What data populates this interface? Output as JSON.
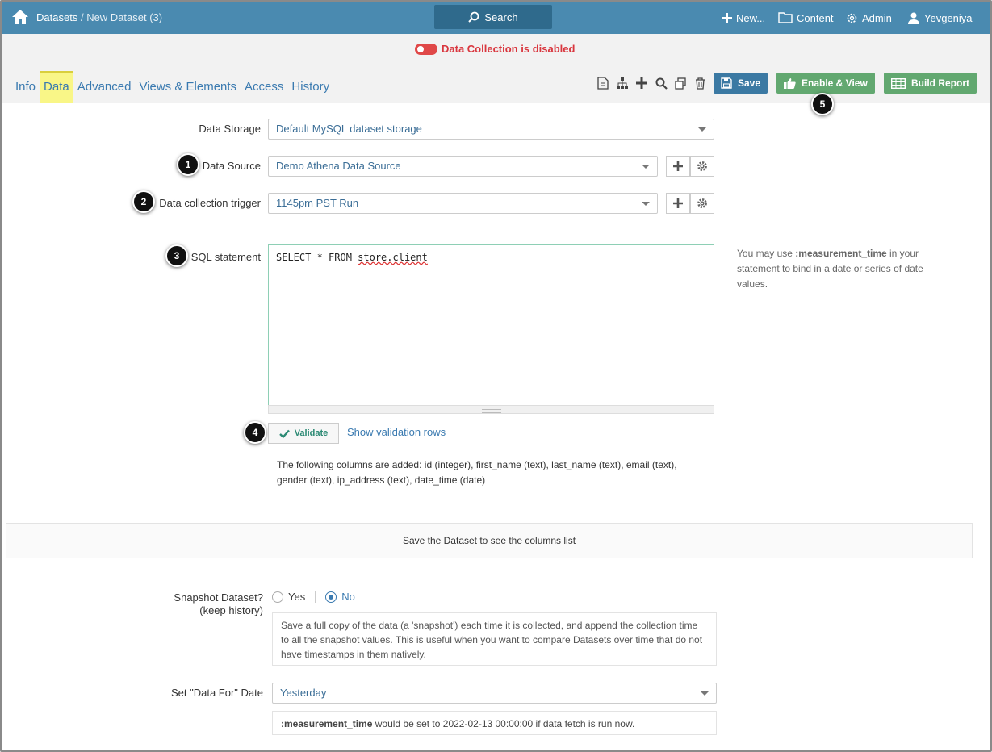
{
  "topbar": {
    "breadcrumb_root": "Datasets",
    "breadcrumb_sep": "/",
    "breadcrumb_current": "New Dataset (3)",
    "search_label": "Search",
    "new_label": "New...",
    "content_label": "Content",
    "admin_label": "Admin",
    "user_label": "Yevgeniya",
    "bg_color": "#4a8ab0"
  },
  "status": {
    "text": "Data Collection is disabled",
    "color": "#d9363e"
  },
  "tabs": [
    {
      "label": "Info"
    },
    {
      "label": "Data",
      "active": true
    },
    {
      "label": "Advanced"
    },
    {
      "label": "Views & Elements"
    },
    {
      "label": "Access"
    },
    {
      "label": "History"
    }
  ],
  "toolbar": {
    "icons": [
      "document-icon",
      "hierarchy-icon",
      "plus-icon",
      "search-icon",
      "copy-icon",
      "trash-icon"
    ],
    "save_label": "Save",
    "enable_label": "Enable & View",
    "report_label": "Build Report"
  },
  "badges": [
    "1",
    "2",
    "3",
    "4",
    "5"
  ],
  "form": {
    "storage_label": "Data Storage",
    "storage_value": "Default MySQL dataset storage",
    "source_label": "Data Source",
    "source_value": "Demo Athena Data Source",
    "trigger_label": "Data collection trigger",
    "trigger_value": "1145pm PST Run",
    "sql_label": "SQL statement",
    "sql_keyword": "SELECT * FROM ",
    "sql_table": "store.client",
    "hint_prefix": "You may use ",
    "hint_bold": ":measurement_time",
    "hint_suffix": " in your statement to bind in a date or series of date values.",
    "validate_label": "Validate",
    "validation_link": "Show validation rows",
    "columns_message": "The following columns are added: id (integer), first_name (text), last_name (text), email (text), gender (text), ip_address (text), date_time (date)"
  },
  "columns_panel": "Save the Dataset to see the columns list",
  "snapshot": {
    "label": "Snapshot Dataset?",
    "sublabel": "(keep history)",
    "yes": "Yes",
    "no": "No",
    "selected": "No",
    "description": "Save a full copy of the data (a 'snapshot') each time it is collected, and append the collection time to all the snapshot values. This is useful when you want to compare Datasets over time that do not have timestamps in them natively."
  },
  "data_for": {
    "label": "Set \"Data For\" Date",
    "value": "Yesterday",
    "note_bold": ":measurement_time",
    "note_rest": " would be set to 2022-02-13 00:00:00 if data fetch is run now."
  }
}
